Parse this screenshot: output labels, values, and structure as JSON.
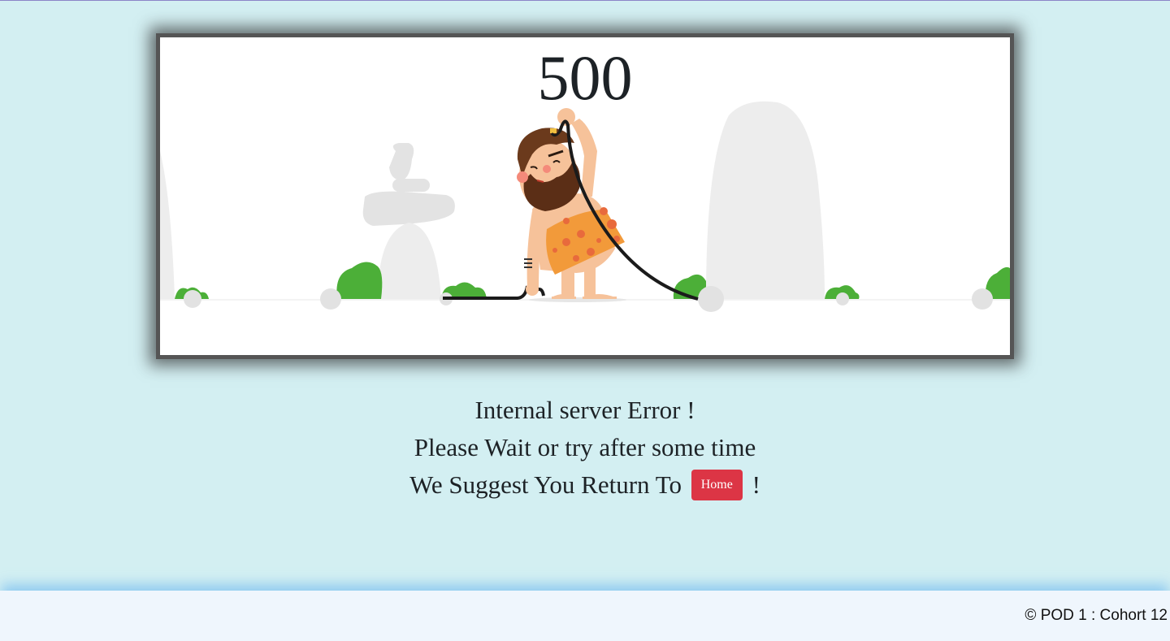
{
  "error": {
    "code": "500",
    "illustration": "caveman-unplugged-cable-illustration"
  },
  "message": {
    "line1": "Internal server Error !",
    "line2": "Please Wait or try after some time",
    "line3_prefix": "We Suggest You Return To",
    "home_button_label": "Home",
    "line3_suffix": "!"
  },
  "footer": {
    "copyright": "© POD 1 : Cohort 12"
  },
  "colors": {
    "page_background": "#d3eff2",
    "frame_border": "#555555",
    "home_button": "#dc3545",
    "footer_background": "#eff6fd"
  }
}
